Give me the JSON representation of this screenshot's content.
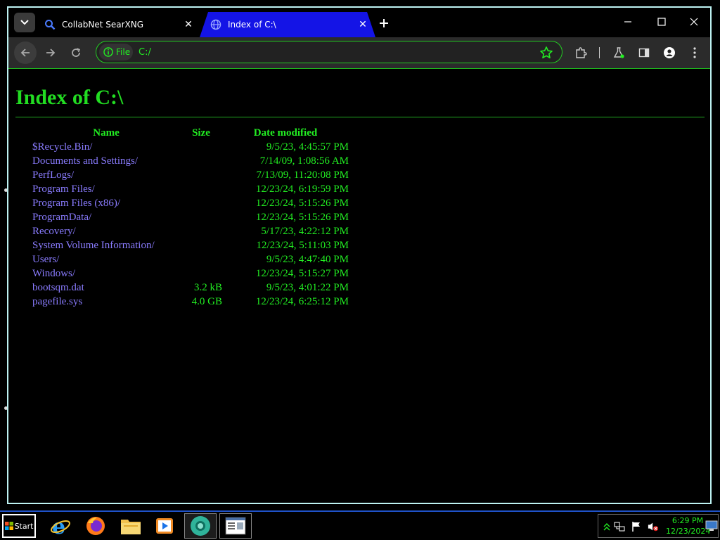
{
  "browser": {
    "tabs": [
      {
        "title": "CollabNet SearXNG",
        "favicon": "search-icon",
        "active": false
      },
      {
        "title": "Index of C:\\",
        "favicon": "globe-icon",
        "active": true
      }
    ],
    "toolbar": {
      "origin_label": "File",
      "url": "C:/"
    }
  },
  "page": {
    "title": "Index of C:\\",
    "columns": {
      "name": "Name",
      "size": "Size",
      "date": "Date modified"
    },
    "rows": [
      {
        "name": "$Recycle.Bin/",
        "size": "",
        "date": "9/5/23, 4:45:57 PM"
      },
      {
        "name": "Documents and Settings/",
        "size": "",
        "date": "7/14/09, 1:08:56 AM"
      },
      {
        "name": "PerfLogs/",
        "size": "",
        "date": "7/13/09, 11:20:08 PM"
      },
      {
        "name": "Program Files/",
        "size": "",
        "date": "12/23/24, 6:19:59 PM"
      },
      {
        "name": "Program Files (x86)/",
        "size": "",
        "date": "12/23/24, 5:15:26 PM"
      },
      {
        "name": "ProgramData/",
        "size": "",
        "date": "12/23/24, 5:15:26 PM"
      },
      {
        "name": "Recovery/",
        "size": "",
        "date": "5/17/23, 4:22:12 PM"
      },
      {
        "name": "System Volume Information/",
        "size": "",
        "date": "12/23/24, 5:11:03 PM"
      },
      {
        "name": "Users/",
        "size": "",
        "date": "9/5/23, 4:47:40 PM"
      },
      {
        "name": "Windows/",
        "size": "",
        "date": "12/23/24, 5:15:27 PM"
      },
      {
        "name": "bootsqm.dat",
        "size": "3.2 kB",
        "date": "9/5/23, 4:01:22 PM"
      },
      {
        "name": "pagefile.sys",
        "size": "4.0 GB",
        "date": "12/23/24, 6:25:12 PM"
      }
    ]
  },
  "taskbar": {
    "start_label": "Start",
    "apps": [
      "internet-explorer-icon",
      "firefox-icon",
      "file-explorer-icon",
      "media-player-icon",
      "chrome-icon",
      "window-icon"
    ],
    "clock_time": "6:29 PM",
    "clock_date": "12/23/2024"
  },
  "colors": {
    "accent": "#22ee22",
    "link": "#8a7cff",
    "active_tab": "#1414e6",
    "taskbar_border": "#1f52c9"
  }
}
